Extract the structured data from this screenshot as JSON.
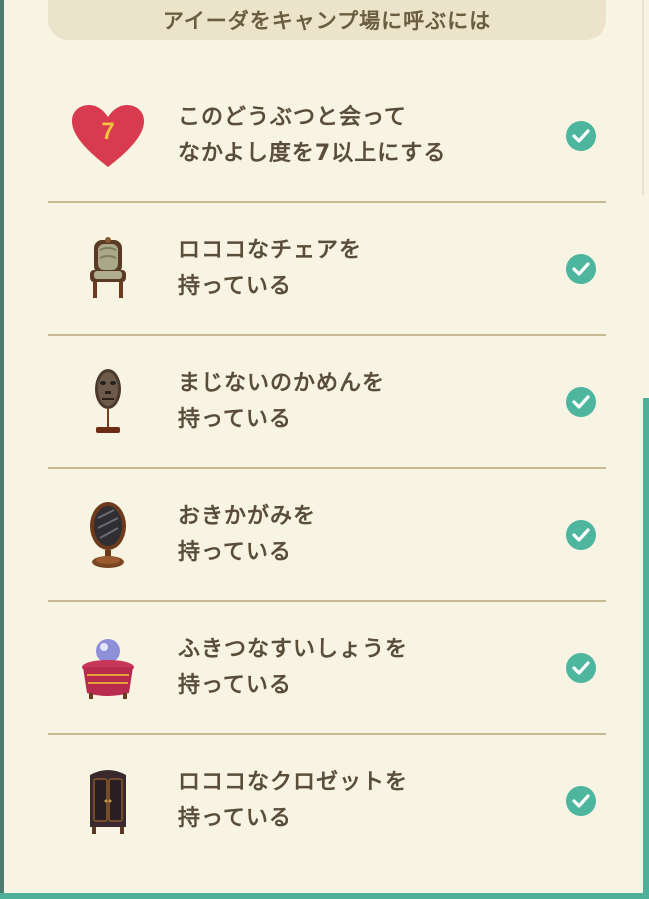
{
  "title": "アイーダをキャンプ場に呼ぶには",
  "conditions": [
    {
      "line1": "このどうぶつと会って",
      "line2": "なかよし度を7以上にする",
      "icon": "heart-icon",
      "icon_text": "7",
      "status": "done"
    },
    {
      "line1": "ロココなチェアを",
      "line2": "持っている",
      "icon": "rococo-chair-icon",
      "status": "done"
    },
    {
      "line1": "まじないのかめんを",
      "line2": "持っている",
      "icon": "mask-icon",
      "status": "done"
    },
    {
      "line1": "おきかがみを",
      "line2": "持っている",
      "icon": "mirror-icon",
      "status": "done"
    },
    {
      "line1": "ふきつなすいしょうを",
      "line2": "持っている",
      "icon": "crystal-ball-icon",
      "status": "done"
    },
    {
      "line1": "ロココなクロゼットを",
      "line2": "持っている",
      "icon": "rococo-closet-icon",
      "status": "done"
    }
  ],
  "colors": {
    "background": "#f8f4e3",
    "title_pill": "#ece3cb",
    "check": "#4eb59e",
    "heart": "#d83a4f",
    "divider": "#c7b994"
  }
}
